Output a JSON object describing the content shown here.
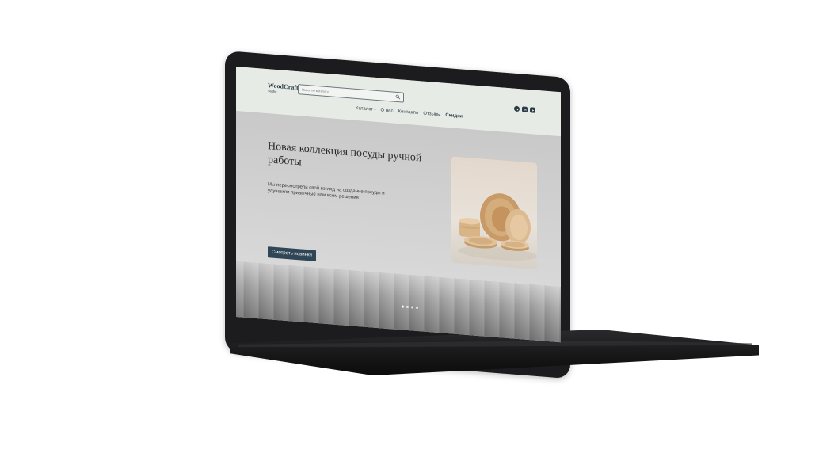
{
  "header": {
    "brand_name": "WoodCraft",
    "brand_sub": "Studio",
    "search_placeholder": "Поиск по каталогу"
  },
  "nav": {
    "catalog": "Каталог",
    "about": "О нас",
    "contacts": "Контакты",
    "reviews": "Отзывы",
    "sale": "Скидки"
  },
  "socials": [
    "telegram-icon",
    "vk-icon",
    "youtube-icon"
  ],
  "hero": {
    "title": "Новая коллекция посуды ручной работы",
    "text": "Мы пересмотрели свой взгляд на создание посуды и улучшили привычные нам всем решения",
    "button": "Смотреть новинки"
  },
  "slider": {
    "slides": 4,
    "active": 1
  },
  "colors": {
    "header_bg": "#e7ebe5",
    "accent": "#2f4657",
    "laptop": "#1c1c1e"
  }
}
